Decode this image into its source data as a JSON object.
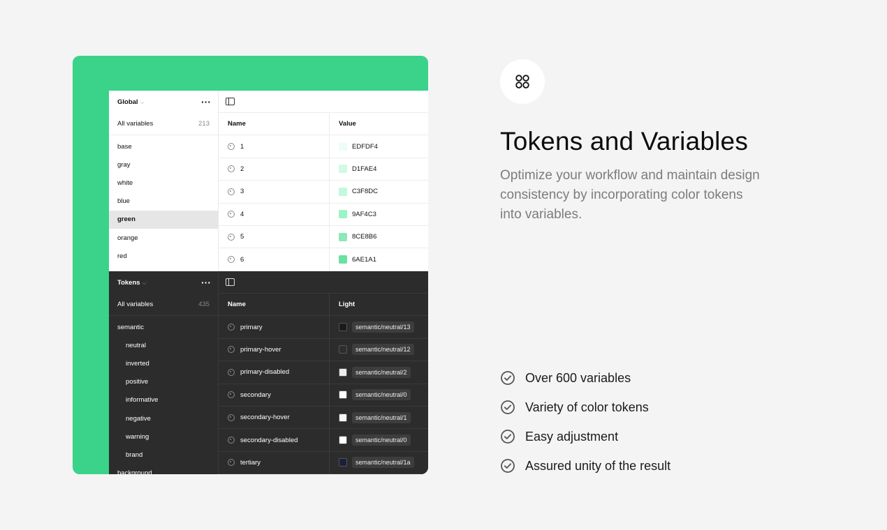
{
  "light_panel": {
    "collection": "Global",
    "all_label": "All variables",
    "all_count": "213",
    "groups": [
      "base",
      "gray",
      "white",
      "blue",
      "green",
      "orange",
      "red"
    ],
    "selected_group": "green",
    "col_name": "Name",
    "col_value": "Value",
    "rows": [
      {
        "name": "1",
        "value": "EDFDF4",
        "color": "#EDFDF4"
      },
      {
        "name": "2",
        "value": "D1FAE4",
        "color": "#D1FAE4"
      },
      {
        "name": "3",
        "value": "C3F8DC",
        "color": "#C3F8DC"
      },
      {
        "name": "4",
        "value": "9AF4C3",
        "color": "#9AF4C3"
      },
      {
        "name": "5",
        "value": "8CE8B6",
        "color": "#8CE8B6"
      },
      {
        "name": "6",
        "value": "6AE1A1",
        "color": "#6AE1A1"
      }
    ]
  },
  "dark_panel": {
    "collection": "Tokens",
    "all_label": "All variables",
    "all_count": "435",
    "groups": [
      {
        "label": "semantic",
        "sub": false
      },
      {
        "label": "neutral",
        "sub": true
      },
      {
        "label": "inverted",
        "sub": true
      },
      {
        "label": "positive",
        "sub": true
      },
      {
        "label": "informative",
        "sub": true
      },
      {
        "label": "negative",
        "sub": true
      },
      {
        "label": "warning",
        "sub": true
      },
      {
        "label": "brand",
        "sub": true
      },
      {
        "label": "background",
        "sub": false
      }
    ],
    "col_name": "Name",
    "col_value": "Light",
    "rows": [
      {
        "name": "primary",
        "value": "semantic/neutral/13",
        "color": "#1b1b1b"
      },
      {
        "name": "primary-hover",
        "value": "semantic/neutral/12",
        "color": "#2e2e2e"
      },
      {
        "name": "primary-disabled",
        "value": "semantic/neutral/2",
        "color": "#ececec"
      },
      {
        "name": "secondary",
        "value": "semantic/neutral/0",
        "color": "#ffffff"
      },
      {
        "name": "secondary-hover",
        "value": "semantic/neutral/1",
        "color": "#f6f6f6"
      },
      {
        "name": "secondary-disabled",
        "value": "semantic/neutral/0",
        "color": "#ffffff"
      },
      {
        "name": "tertiary",
        "value": "semantic/neutral/1a",
        "color": "#1b1f3a"
      }
    ]
  },
  "feature_block": {
    "title": "Tokens and Variables",
    "description": "Optimize your workflow and maintain design consistency by incorporating color tokens into variables.",
    "icon": "four-circles-icon",
    "features": [
      "Over 600 variables",
      "Variety of color tokens",
      "Easy adjustment",
      "Assured unity of the result"
    ],
    "check_icon": "check-circle-icon"
  },
  "colors": {
    "accent_green": "#3bd289",
    "dark_panel": "#2c2c2c",
    "page_bg": "#f4f4f4"
  }
}
